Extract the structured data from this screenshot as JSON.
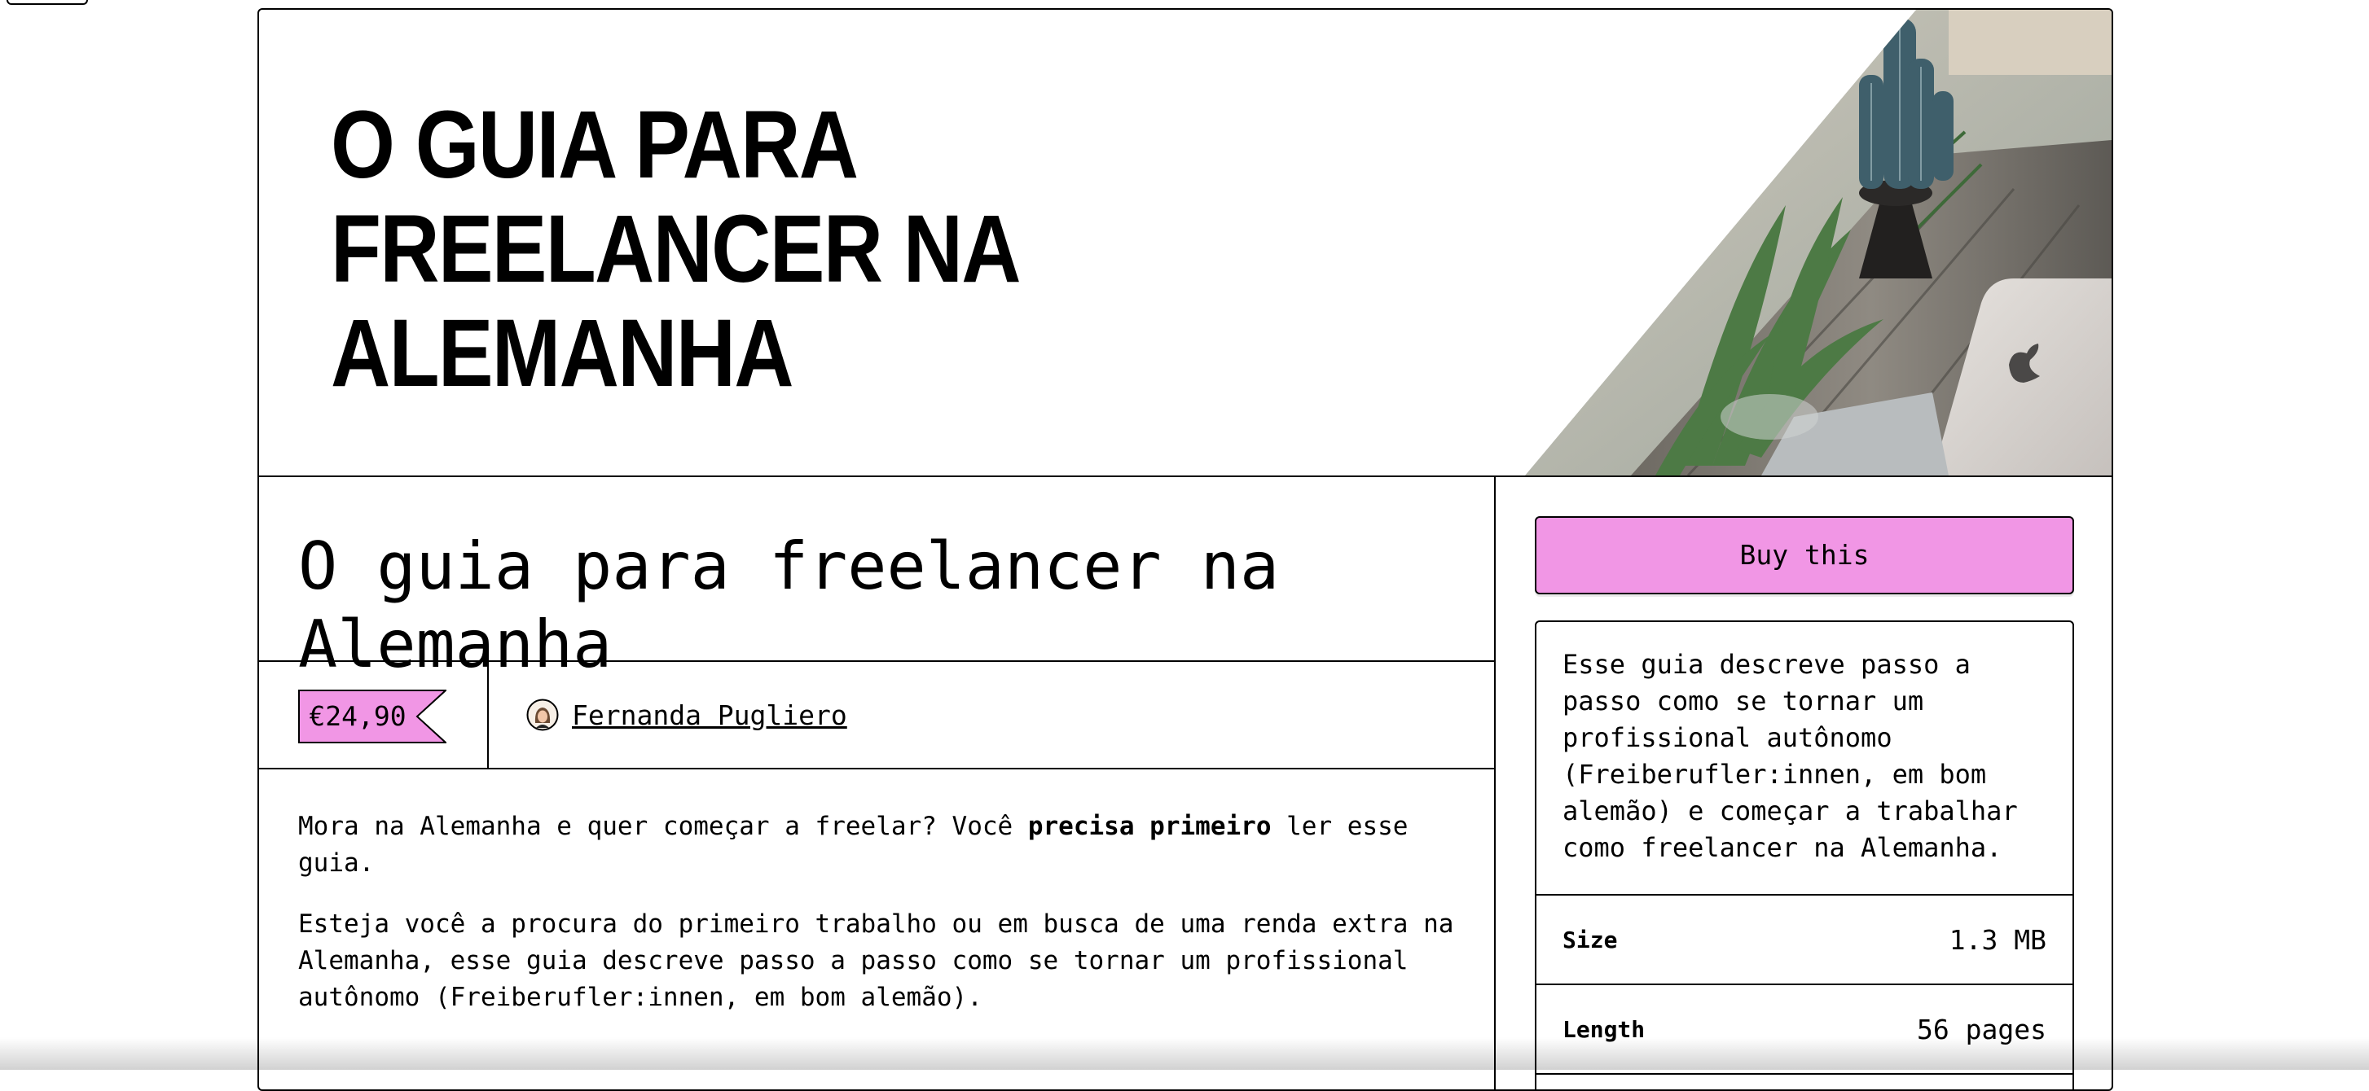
{
  "cover": {
    "line1": "O GUIA PARA",
    "line2": "FREELANCER NA",
    "line3": "ALEMANHA",
    "photo": "desk-with-cactus-and-laptop-photo"
  },
  "product": {
    "title": "O guia para freelancer na Alemanha",
    "price": "€24,90",
    "author": "Fernanda Pugliero",
    "description": [
      {
        "before": "Mora na Alemanha e quer começar a freelar? Você ",
        "bold": "precisa primeiro",
        "after": " ler esse guia."
      },
      {
        "text": "Esteja você a procura do primeiro trabalho ou em busca de uma renda extra na Alemanha, esse guia descreve passo a passo como se tornar um profissional autônomo (Freiberufler:innen, em bom alemão)."
      }
    ]
  },
  "sidebar": {
    "buy_label": "Buy this",
    "summary": "Esse guia descreve passo a\npasso como se tornar um\nprofissional autônomo\n(Freiberufler:innen, em bom\nalemão) e começar a trabalhar\ncomo freelancer na Alemanha.",
    "specs": [
      {
        "label": "Size",
        "value": "1.3 MB"
      },
      {
        "label": "Length",
        "value": "56 pages"
      }
    ]
  },
  "colors": {
    "accent": "#f196e5",
    "border": "#000000",
    "background": "#ffffff"
  }
}
